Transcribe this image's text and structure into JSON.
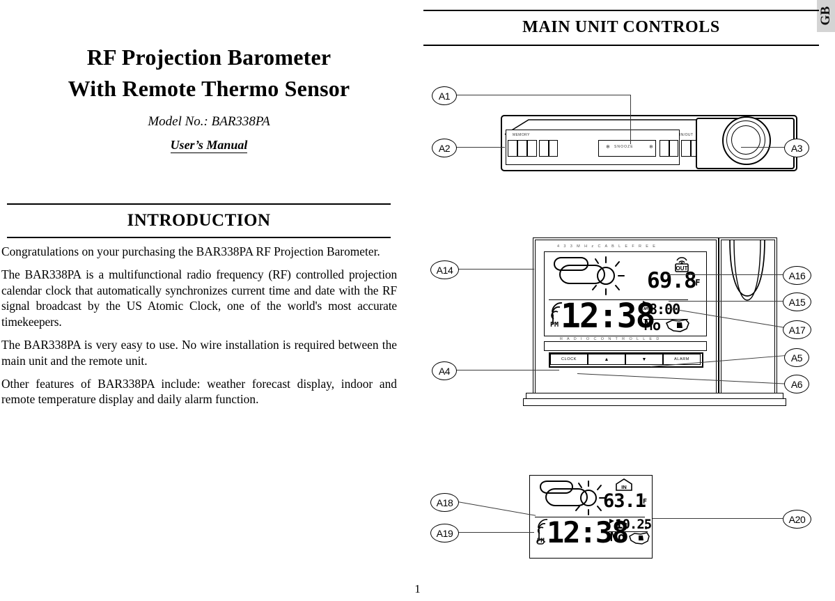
{
  "page": {
    "language_tab": "GB",
    "page_number": "1"
  },
  "cover": {
    "title_line1": "RF Projection Barometer",
    "title_line2": "With Remote Thermo Sensor",
    "model_label": "Model No.: BAR338PA",
    "manual_label": "User’s  Manual"
  },
  "introduction": {
    "heading": "INTRODUCTION",
    "paragraphs": [
      "Congratulations on your purchasing the BAR338PA RF Projection Barometer.",
      "The BAR338PA is a multifunctional radio frequency (RF) controlled projection calendar clock that automatically synchronizes current time and date with the RF signal  broadcast by the US Atomic Clock, one of the world's most accurate timekeepers.",
      "The BAR338PA is very easy to use. No wire installation is required between the main unit and the remote unit.",
      "Other features of BAR338PA include: weather forecast display, indoor and remote temperature display and daily alarm function."
    ]
  },
  "main_unit_controls": {
    "heading": "MAIN  UNIT  CONTROLS",
    "figure_front_panel": {
      "callouts": [
        "A1",
        "A2",
        "A3"
      ],
      "button_labels": {
        "memory": "MEMORY",
        "snooze": "SNOOZE",
        "in_out": "IN/OUT"
      }
    },
    "figure_main_unit": {
      "callouts_left": [
        "A14",
        "A4"
      ],
      "callouts_right": [
        "A16",
        "A15",
        "A17",
        "A5",
        "A6"
      ],
      "lcd_top_label": "4 3 3 M H z     C A B L E     F R E E",
      "lcd_bottom_label": "R A D I O    C O N T R O L L E D",
      "lcd_temperature": "69.8",
      "lcd_temperature_unit": "°F",
      "lcd_temperature_source": "OUT",
      "lcd_time": "12:38",
      "lcd_meridiem": "PM",
      "lcd_alarm_time": "8:00",
      "lcd_alarm_meridiem": "AM",
      "lcd_weekday": "Mo",
      "buttons": [
        "CLOCK",
        "▲",
        "▼",
        "ALARM"
      ]
    },
    "figure_remote_lcd": {
      "callouts_left": [
        "A18",
        "A19"
      ],
      "callouts_right": [
        "A20"
      ],
      "lcd_temperature": "63.1",
      "lcd_temperature_unit": "°F",
      "lcd_temperature_source": "IN",
      "lcd_time": "12:38",
      "lcd_meridiem": "PM",
      "lcd_date": "10.25",
      "lcd_date_month_tag": "M",
      "lcd_date_day_tag": "D",
      "lcd_weekday": "Mo"
    }
  }
}
